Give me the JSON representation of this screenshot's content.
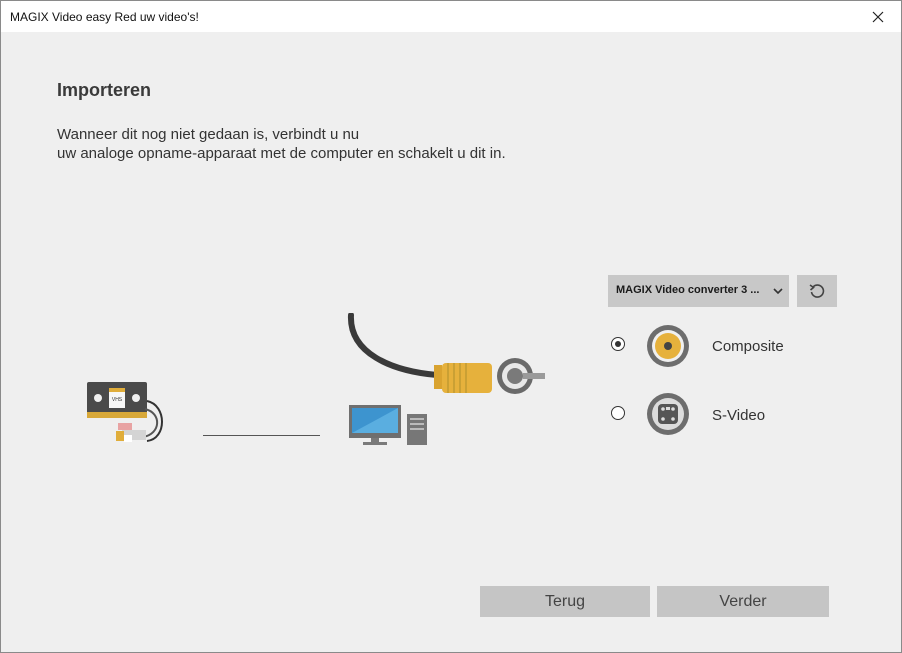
{
  "window": {
    "title": "MAGIX Video easy Red uw video's!"
  },
  "page": {
    "heading": "Importeren",
    "instruction_line1": "Wanneer dit nog niet gedaan is, verbindt u nu",
    "instruction_line2": "uw analoge opname-apparaat met de computer en schakelt u dit in."
  },
  "device_select": {
    "selected": "MAGIX Video converter 3 ..."
  },
  "vhs_label": "VHS",
  "inputs": [
    {
      "label": "Composite",
      "selected": true,
      "icon": "composite-connector-icon"
    },
    {
      "label": "S-Video",
      "selected": false,
      "icon": "svideo-connector-icon"
    }
  ],
  "buttons": {
    "back": "Terug",
    "next": "Verder"
  },
  "icons": [
    "close-icon",
    "chevron-down-icon",
    "refresh-icon",
    "vhs-recorder-icon",
    "computer-icon",
    "rca-cable-icon"
  ],
  "colors": {
    "background": "#efefef",
    "button": "#c5c5c5",
    "rca_yellow": "#e6b13c",
    "cable": "#3a3a3a"
  }
}
